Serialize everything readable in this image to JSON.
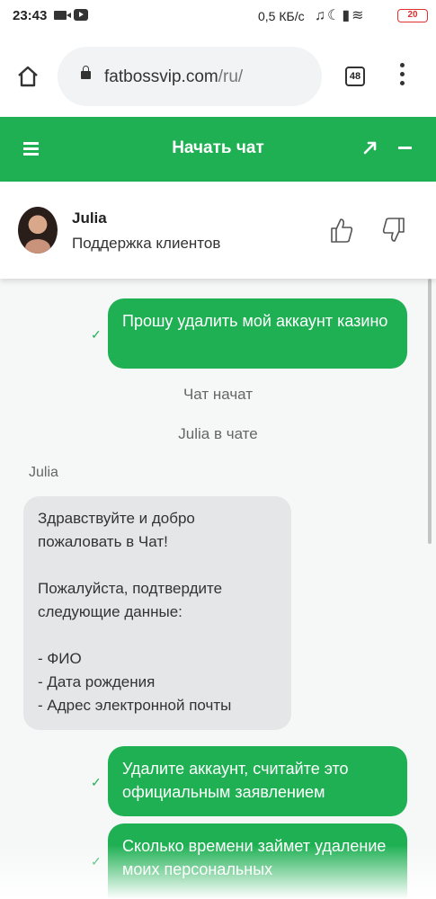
{
  "status_bar": {
    "time": "23:43",
    "network_speed": "0,5 КБ/с",
    "battery": "20"
  },
  "browser": {
    "url_host": "fatbossvip.com",
    "url_path": "/ru/",
    "tab_count": "48"
  },
  "chat_header": {
    "title": "Начать чат"
  },
  "agent": {
    "name": "Julia",
    "role": "Поддержка клиентов"
  },
  "messages": [
    {
      "type": "outgoing",
      "text": "Прошу удалить мой аккаунт казино"
    },
    {
      "type": "system",
      "text": "Чат начат"
    },
    {
      "type": "system",
      "text": "Julia в чате"
    },
    {
      "type": "sender",
      "text": "Julia"
    },
    {
      "type": "incoming",
      "text": "Здравствуйте и добро пожаловать в Чат!\n\nПожалуйста, подтвердите следующие данные:\n\n- ФИО\n- Дата рождения\n- Адрес электронной почты"
    },
    {
      "type": "outgoing",
      "text": "Удалите аккаунт, считайте это официальным заявлением"
    },
    {
      "type": "outgoing",
      "text": "Сколько времени займет удаление моих персональных"
    }
  ],
  "colors": {
    "accent": "#1eb053",
    "incoming_bubble": "#e4e6e7",
    "chat_background": "#f6f7f7"
  }
}
